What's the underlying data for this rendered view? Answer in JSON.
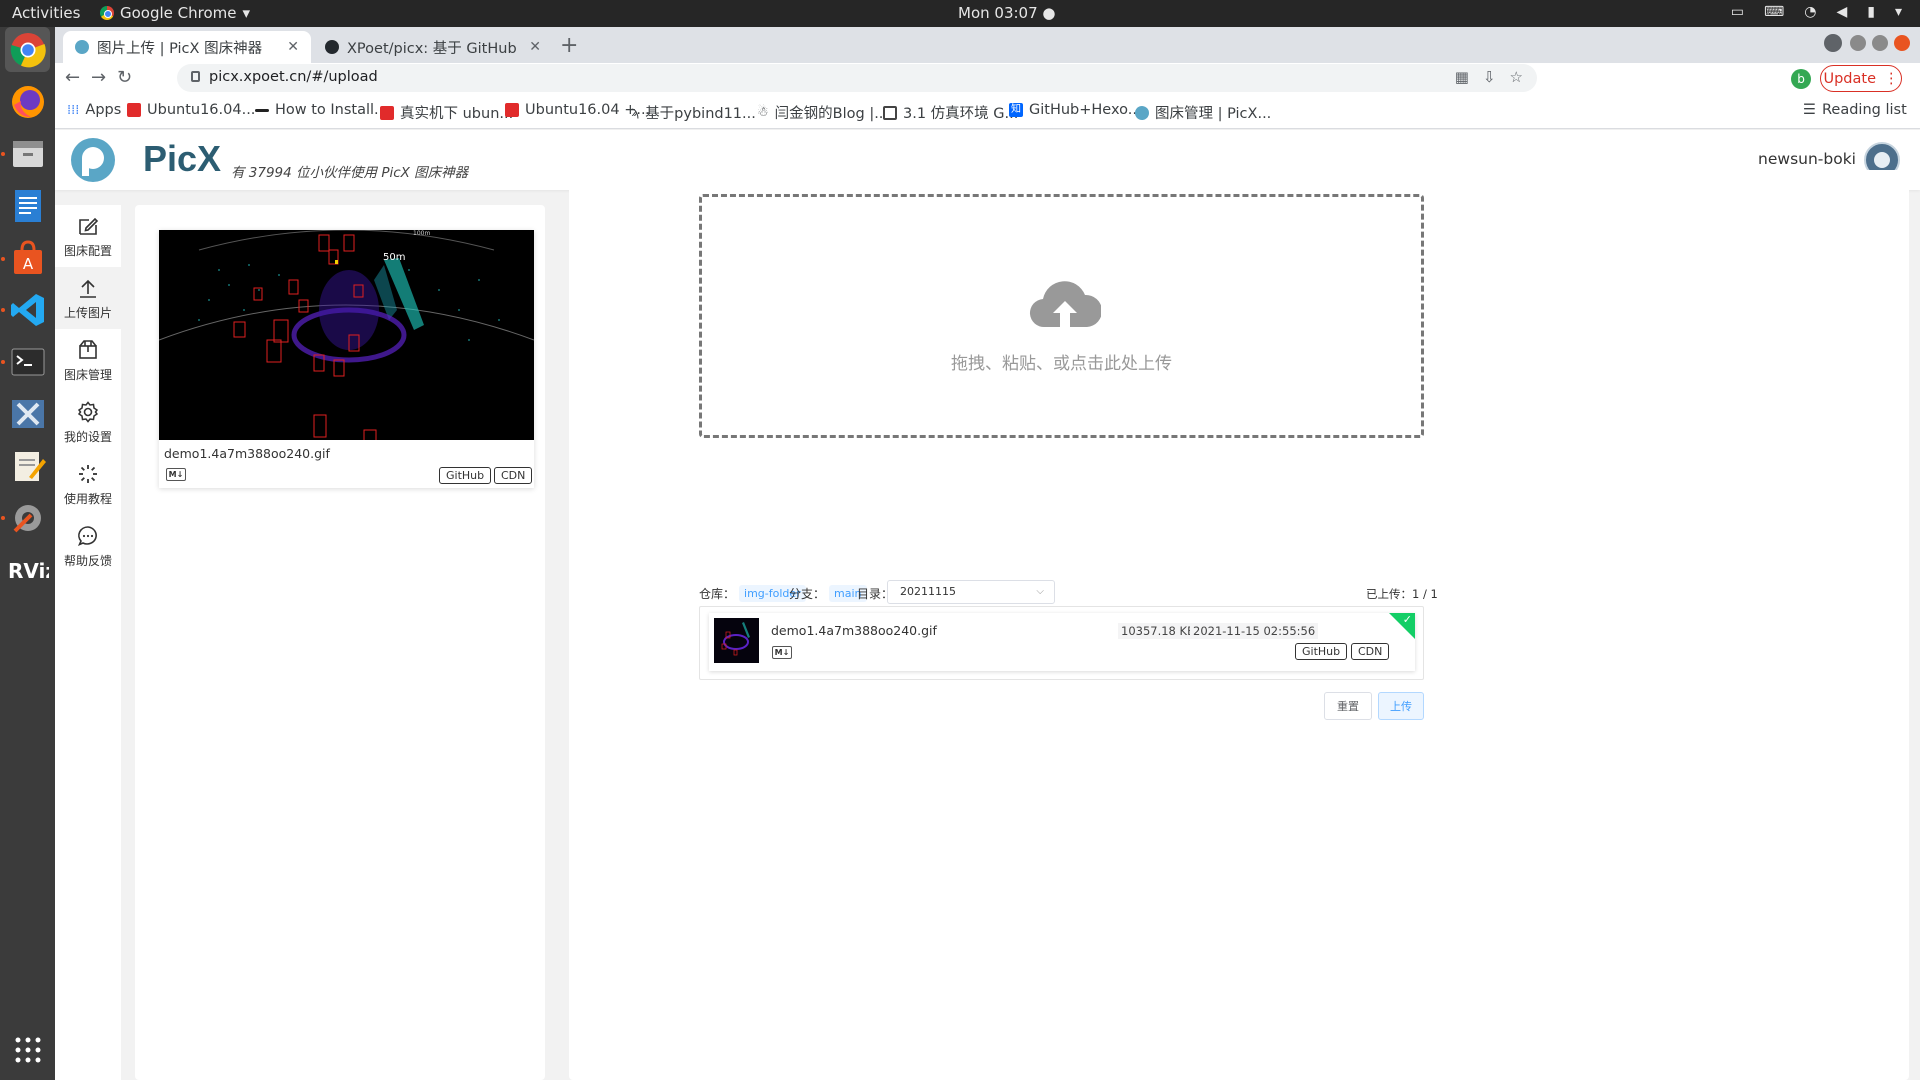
{
  "os": {
    "activities": "Activities",
    "app_menu": "Google Chrome",
    "clock": "Mon 03:07 ●"
  },
  "browser": {
    "tabs": [
      {
        "title": "图片上传 | PicX 图床神器",
        "active": true
      },
      {
        "title": "XPoet/picx: 基于 GitHub A",
        "active": false
      }
    ],
    "new_tab": "+",
    "url": "picx.xpoet.cn/#/upload",
    "profile_initial": "b",
    "update_label": "Update",
    "bookmarks": [
      "Apps",
      "Ubuntu16.04...",
      "How to Install...",
      "真实机下 ubun...",
      "Ubuntu16.04 +...",
      "基于pybind11...",
      "闫金钢的Blog |...",
      "3.1 仿真环境 G...",
      "GitHub+Hexo...",
      "图床管理 | PicX..."
    ],
    "reading_list": "Reading list"
  },
  "header": {
    "logo_text": "PicX",
    "tagline": "有 37994 位小伙伴使用 PicX 图床神器",
    "username": "newsun-boki"
  },
  "nav": {
    "items": [
      {
        "label": "图床配置",
        "icon": "edit-icon"
      },
      {
        "label": "上传图片",
        "icon": "upload-icon",
        "active": true
      },
      {
        "label": "图床管理",
        "icon": "box-icon"
      },
      {
        "label": "我的设置",
        "icon": "gear-icon"
      },
      {
        "label": "使用教程",
        "icon": "spinner-icon"
      },
      {
        "label": "帮助反馈",
        "icon": "chat-icon"
      }
    ]
  },
  "preview": {
    "filename": "demo1.4a7m388oo240.gif",
    "md_label": "M↓",
    "github_label": "GitHub",
    "cdn_label": "CDN",
    "overlay_50m": "50m",
    "overlay_100m": "100m"
  },
  "upload": {
    "drop_text": "拖拽、粘贴、或点击此处上传",
    "repo_label": "仓库：",
    "repo_value": "img-folder",
    "branch_label": "分支：",
    "branch_value": "main",
    "dir_label": "目录：",
    "dir_value": "20211115",
    "uploaded_label": "已上传：",
    "uploaded_value": "1 / 1",
    "file": {
      "name": "demo1.4a7m388oo240.gif",
      "size": "10357.18 KB",
      "date": "2021-11-15 02:55:56",
      "md_label": "M↓",
      "github_label": "GitHub",
      "cdn_label": "CDN",
      "done_mark": "✓"
    },
    "reset_label": "重置",
    "upload_label": "上传"
  },
  "colors": {
    "accent": "#409eff",
    "success": "#13ce66",
    "brand": "#2c5d72"
  }
}
